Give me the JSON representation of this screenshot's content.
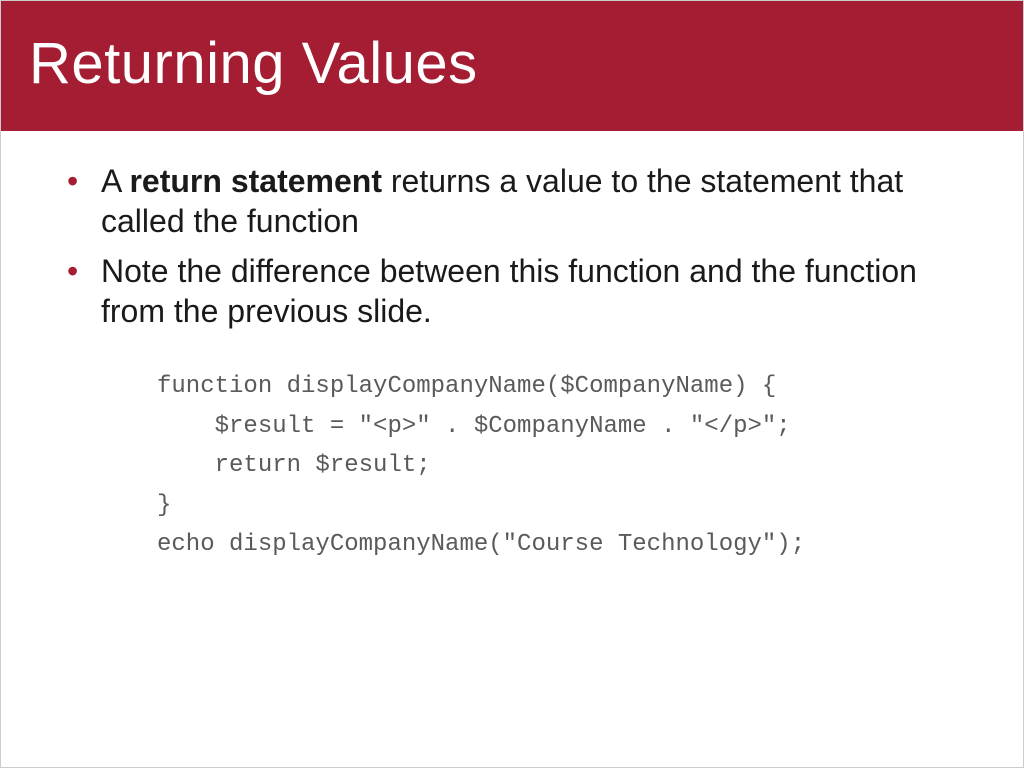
{
  "title": "Returning Values",
  "bullets": [
    {
      "pre": "A ",
      "bold": "return statement",
      "post": " returns a value to the statement that called the function"
    },
    {
      "pre": "Note the difference between this function and the function from the previous slide.",
      "bold": "",
      "post": ""
    }
  ],
  "code": "function displayCompanyName($CompanyName) {\n    $result = \"<p>\" . $CompanyName . \"</p>\";\n    return $result;\n}\necho displayCompanyName(\"Course Technology\");"
}
